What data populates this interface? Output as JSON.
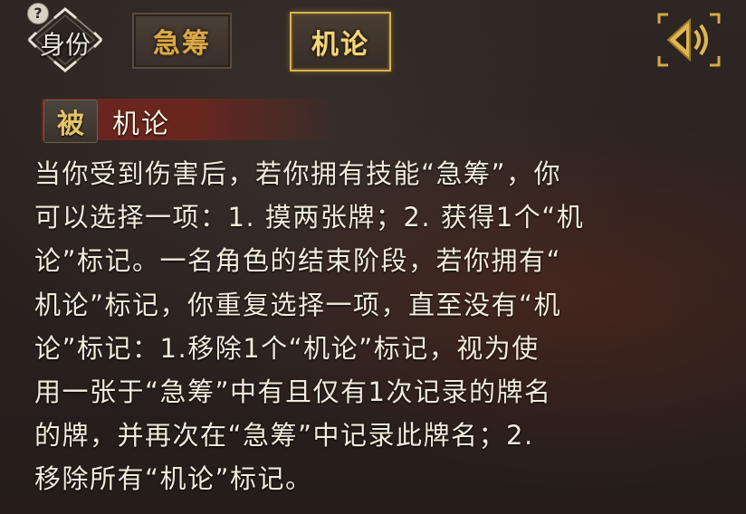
{
  "header": {
    "help_icon": "?",
    "identity_label": "身份",
    "tabs": [
      {
        "label": "急筹",
        "active": false
      },
      {
        "label": "机论",
        "active": true
      }
    ],
    "sound_icon": "speaker-icon"
  },
  "skill": {
    "type_badge": "被",
    "name": "机论",
    "description_lines": [
      "当你受到伤害后，若你拥有技能“急筹”，你",
      "可以选择一项：1. 摸两张牌；2. 获得1个“机",
      "论”标记。一名角色的结束阶段，若你拥有“",
      "机论”标记，你重复选择一项，直至没有“机",
      "论”标记：1.移除1个“机论”标记，视为使",
      "用一张于“急筹”中有且仅有1次记录的牌名",
      "的牌，并再次在“急筹”中记录此牌名；2.",
      "移除所有“机论”标记。"
    ]
  },
  "colors": {
    "gold_accent": "#d8b24e",
    "header_red": "#6e261e",
    "text": "#f3ebdc"
  }
}
